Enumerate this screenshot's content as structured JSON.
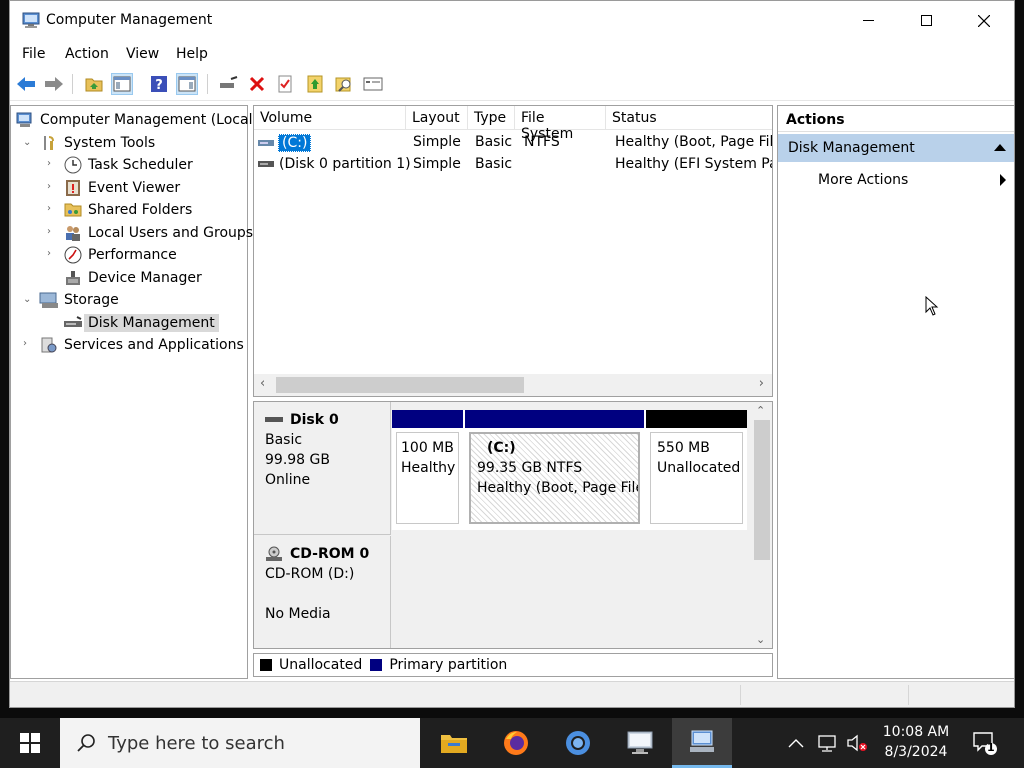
{
  "window": {
    "title": "Computer Management"
  },
  "menu": [
    "File",
    "Action",
    "View",
    "Help"
  ],
  "tree": {
    "root": "Computer Management (Local)",
    "system_tools": "System Tools",
    "task_scheduler": "Task Scheduler",
    "event_viewer": "Event Viewer",
    "shared_folders": "Shared Folders",
    "local_users": "Local Users and Groups",
    "performance": "Performance",
    "device_manager": "Device Manager",
    "storage": "Storage",
    "disk_management": "Disk Management",
    "services": "Services and Applications"
  },
  "volumes": {
    "columns": [
      "Volume",
      "Layout",
      "Type",
      "File System",
      "Status"
    ],
    "rows": [
      {
        "volume": "(C:)",
        "layout": "Simple",
        "type": "Basic",
        "fs": "NTFS",
        "status": "Healthy (Boot, Page File"
      },
      {
        "volume": "(Disk 0 partition 1)",
        "layout": "Simple",
        "type": "Basic",
        "fs": "",
        "status": "Healthy (EFI System Par"
      }
    ]
  },
  "disks": {
    "disk0": {
      "name": "Disk 0",
      "type": "Basic",
      "size": "99.98 GB",
      "state": "Online",
      "partitions": [
        {
          "name": "",
          "size": "100 MB",
          "status": "Healthy"
        },
        {
          "name": "(C:)",
          "size": "99.35 GB NTFS",
          "status": "Healthy (Boot, Page File,"
        },
        {
          "name": "",
          "size": "550 MB",
          "status": "Unallocated"
        }
      ]
    },
    "cdrom": {
      "name": "CD-ROM 0",
      "type": "CD-ROM (D:)",
      "state": "No Media"
    }
  },
  "legend": {
    "unallocated": "Unallocated",
    "primary": "Primary partition",
    "unallocated_color": "#000000",
    "primary_color": "#000080"
  },
  "actions": {
    "title": "Actions",
    "section": "Disk Management",
    "more": "More Actions"
  },
  "taskbar": {
    "search_placeholder": "Type here to search",
    "time": "10:08 AM",
    "date": "8/3/2024",
    "notification_count": "1"
  },
  "colors": {
    "selection": "#0078d7",
    "actions_header": "#b9d1ea",
    "primary_partition": "#000080",
    "unallocated": "#000000"
  }
}
